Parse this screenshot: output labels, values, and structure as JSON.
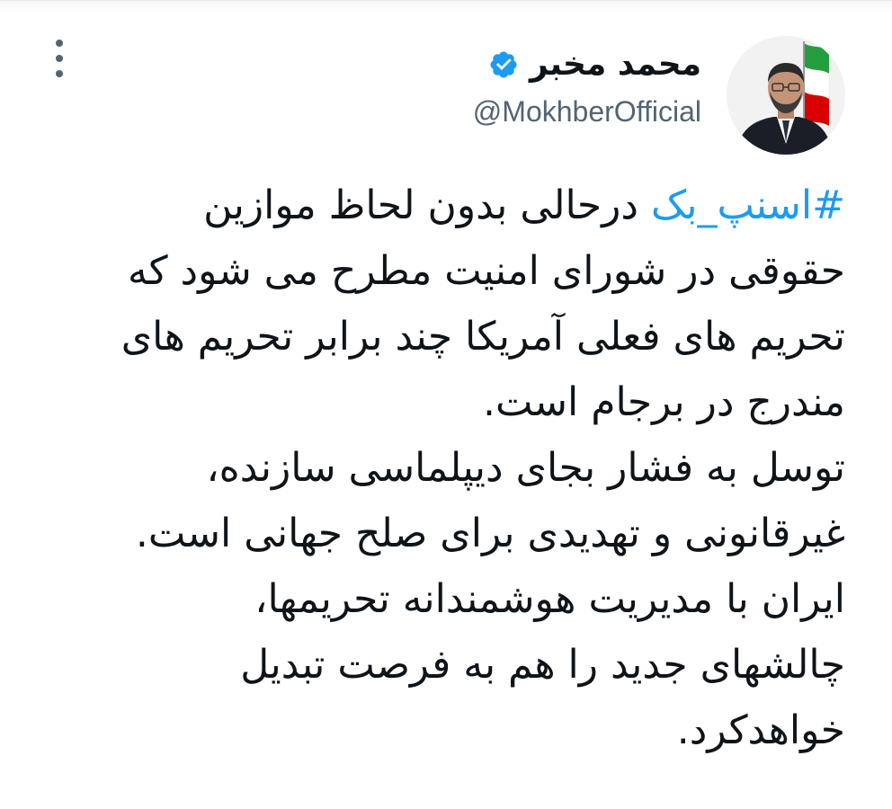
{
  "author": {
    "display_name": "محمد مخبر",
    "handle": "@MokhberOfficial",
    "verified": true,
    "avatar_icon": "profile-photo-with-iran-flag"
  },
  "menu": {
    "icon": "more-options-icon"
  },
  "tweet": {
    "hashtag": "#اسنپ_بک",
    "line_1_rest": " درحالی بدون لحاظ موازین",
    "lines": [
      "حقوقی در شورای امنیت مطرح می شود که",
      "تحریم های فعلی آمریکا چند برابر تحریم های",
      "مندرج در برجام است.",
      "توسل به فشار بجای دیپلماسی سازنده،",
      "غیرقانونی و تهدیدی برای صلح جهانی است.",
      "ایران با مدیریت هوشمندانه تحریمها،",
      "چالشهای جدید را هم به فرصت تبدیل",
      "خواهدکرد."
    ]
  },
  "colors": {
    "text": "#0f1419",
    "secondary": "#536471",
    "link": "#1d9bf0",
    "verified": "#1d9bf0"
  }
}
